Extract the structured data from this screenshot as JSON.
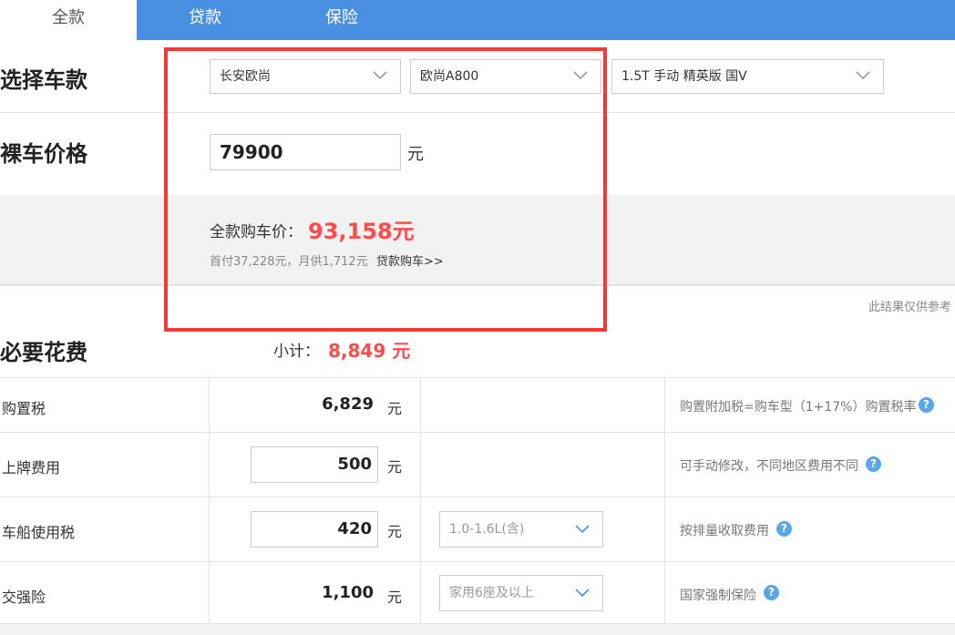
{
  "tabs": [
    {
      "label": "全款",
      "active": true
    },
    {
      "label": "贷款",
      "active": false
    },
    {
      "label": "保险",
      "active": false
    }
  ],
  "select_model": {
    "title": "选择车款",
    "brand": "长安欧尚",
    "series": "欧尚A800",
    "trim": "1.5T 手动 精英版 国V"
  },
  "base_price": {
    "title": "裸车价格",
    "value": "79900",
    "unit": "元"
  },
  "summary": {
    "label": "全款购车价：",
    "total": "93,158元",
    "sub": "首付37,228元，月供1,712元",
    "loan_link": "贷款购车>>"
  },
  "disclaimer": "此结果仅供参考",
  "required_costs": {
    "title": "必要花费",
    "subtotal_label": "小计：",
    "subtotal_value": "8,849 元",
    "rows": [
      {
        "label": "购置税",
        "value": "6,829",
        "unit": "元",
        "note": "购置附加税=购车型（1+17%）购置税率"
      },
      {
        "label": "上牌费用",
        "value": "500",
        "unit": "元",
        "note": "可手动修改，不同地区费用不同"
      },
      {
        "label": "车船使用税",
        "value": "420",
        "unit": "元",
        "option": "1.0-1.6L(含)",
        "note": "按排量收取费用"
      },
      {
        "label": "交强险",
        "value": "1,100",
        "unit": "元",
        "option": "家用6座及以上",
        "note": "国家强制保险"
      }
    ]
  },
  "colors": {
    "accent": "#4a90e2",
    "highlight": "#ff4b4b",
    "annotation": "#f03a3a",
    "help": "#5aa7e8"
  },
  "icons": {
    "select": "chevron-down-icon",
    "help": "question-mark-icon"
  }
}
